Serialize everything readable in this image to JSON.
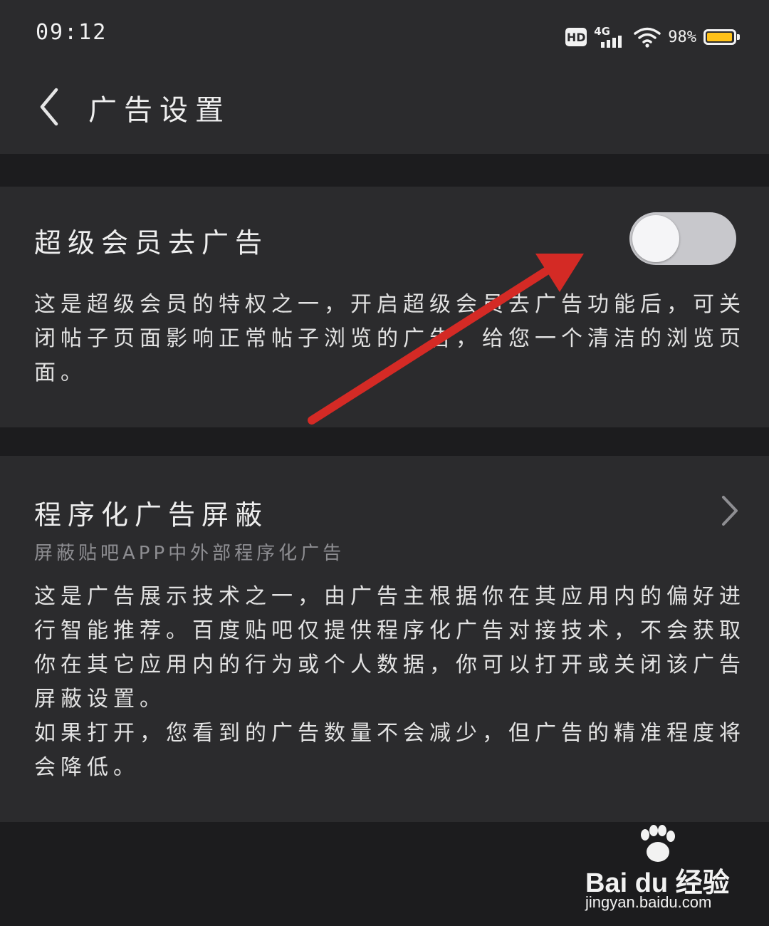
{
  "status_bar": {
    "time": "09:12",
    "hd_label": "HD",
    "network_label": "4G",
    "battery_percent": "98%",
    "battery_level": 0.98,
    "battery_color": "#ffc21a"
  },
  "header": {
    "title": "广告设置",
    "back_icon": "chevron-left-icon"
  },
  "settings": {
    "super_member": {
      "title": "超级会员去广告",
      "toggle_on": false,
      "description": "这是超级会员的特权之一，开启超级会员去广告功能后，可关闭帖子页面影响正常帖子浏览的广告，给您一个清洁的浏览页面。"
    },
    "programmatic": {
      "title": "程序化广告屏蔽",
      "subtitle": "屏蔽贴吧APP中外部程序化广告",
      "description": "这是广告展示技术之一，由广告主根据你在其应用内的偏好进行智能推荐。百度贴吧仅提供程序化广告对接技术，不会获取你在其它应用内的行为或个人数据，你可以打开或关闭该广告屏蔽设置。\n如果打开，您看到的广告数量不会减少，但广告的精准程度将会降低。",
      "chevron_icon": "chevron-right-icon"
    }
  },
  "annotation": {
    "arrow_color": "#d42a25"
  },
  "watermark": {
    "brand_text": "Bai du 经验",
    "url": "jingyan.baidu.com"
  },
  "colors": {
    "background": "#1c1c1e",
    "card": "#2b2b2d",
    "text": "#e6e6e6",
    "secondary_text": "#8e8e92"
  }
}
